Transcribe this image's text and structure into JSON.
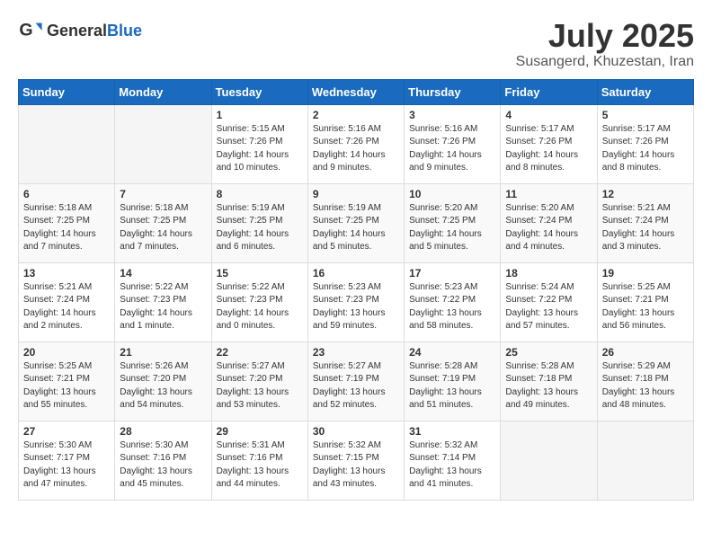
{
  "header": {
    "logo_general": "General",
    "logo_blue": "Blue",
    "month_title": "July 2025",
    "location": "Susangerd, Khuzestan, Iran"
  },
  "weekdays": [
    "Sunday",
    "Monday",
    "Tuesday",
    "Wednesday",
    "Thursday",
    "Friday",
    "Saturday"
  ],
  "weeks": [
    [
      {
        "day": "",
        "info": ""
      },
      {
        "day": "",
        "info": ""
      },
      {
        "day": "1",
        "info": "Sunrise: 5:15 AM\nSunset: 7:26 PM\nDaylight: 14 hours and 10 minutes."
      },
      {
        "day": "2",
        "info": "Sunrise: 5:16 AM\nSunset: 7:26 PM\nDaylight: 14 hours and 9 minutes."
      },
      {
        "day": "3",
        "info": "Sunrise: 5:16 AM\nSunset: 7:26 PM\nDaylight: 14 hours and 9 minutes."
      },
      {
        "day": "4",
        "info": "Sunrise: 5:17 AM\nSunset: 7:26 PM\nDaylight: 14 hours and 8 minutes."
      },
      {
        "day": "5",
        "info": "Sunrise: 5:17 AM\nSunset: 7:26 PM\nDaylight: 14 hours and 8 minutes."
      }
    ],
    [
      {
        "day": "6",
        "info": "Sunrise: 5:18 AM\nSunset: 7:25 PM\nDaylight: 14 hours and 7 minutes."
      },
      {
        "day": "7",
        "info": "Sunrise: 5:18 AM\nSunset: 7:25 PM\nDaylight: 14 hours and 7 minutes."
      },
      {
        "day": "8",
        "info": "Sunrise: 5:19 AM\nSunset: 7:25 PM\nDaylight: 14 hours and 6 minutes."
      },
      {
        "day": "9",
        "info": "Sunrise: 5:19 AM\nSunset: 7:25 PM\nDaylight: 14 hours and 5 minutes."
      },
      {
        "day": "10",
        "info": "Sunrise: 5:20 AM\nSunset: 7:25 PM\nDaylight: 14 hours and 5 minutes."
      },
      {
        "day": "11",
        "info": "Sunrise: 5:20 AM\nSunset: 7:24 PM\nDaylight: 14 hours and 4 minutes."
      },
      {
        "day": "12",
        "info": "Sunrise: 5:21 AM\nSunset: 7:24 PM\nDaylight: 14 hours and 3 minutes."
      }
    ],
    [
      {
        "day": "13",
        "info": "Sunrise: 5:21 AM\nSunset: 7:24 PM\nDaylight: 14 hours and 2 minutes."
      },
      {
        "day": "14",
        "info": "Sunrise: 5:22 AM\nSunset: 7:23 PM\nDaylight: 14 hours and 1 minute."
      },
      {
        "day": "15",
        "info": "Sunrise: 5:22 AM\nSunset: 7:23 PM\nDaylight: 14 hours and 0 minutes."
      },
      {
        "day": "16",
        "info": "Sunrise: 5:23 AM\nSunset: 7:23 PM\nDaylight: 13 hours and 59 minutes."
      },
      {
        "day": "17",
        "info": "Sunrise: 5:23 AM\nSunset: 7:22 PM\nDaylight: 13 hours and 58 minutes."
      },
      {
        "day": "18",
        "info": "Sunrise: 5:24 AM\nSunset: 7:22 PM\nDaylight: 13 hours and 57 minutes."
      },
      {
        "day": "19",
        "info": "Sunrise: 5:25 AM\nSunset: 7:21 PM\nDaylight: 13 hours and 56 minutes."
      }
    ],
    [
      {
        "day": "20",
        "info": "Sunrise: 5:25 AM\nSunset: 7:21 PM\nDaylight: 13 hours and 55 minutes."
      },
      {
        "day": "21",
        "info": "Sunrise: 5:26 AM\nSunset: 7:20 PM\nDaylight: 13 hours and 54 minutes."
      },
      {
        "day": "22",
        "info": "Sunrise: 5:27 AM\nSunset: 7:20 PM\nDaylight: 13 hours and 53 minutes."
      },
      {
        "day": "23",
        "info": "Sunrise: 5:27 AM\nSunset: 7:19 PM\nDaylight: 13 hours and 52 minutes."
      },
      {
        "day": "24",
        "info": "Sunrise: 5:28 AM\nSunset: 7:19 PM\nDaylight: 13 hours and 51 minutes."
      },
      {
        "day": "25",
        "info": "Sunrise: 5:28 AM\nSunset: 7:18 PM\nDaylight: 13 hours and 49 minutes."
      },
      {
        "day": "26",
        "info": "Sunrise: 5:29 AM\nSunset: 7:18 PM\nDaylight: 13 hours and 48 minutes."
      }
    ],
    [
      {
        "day": "27",
        "info": "Sunrise: 5:30 AM\nSunset: 7:17 PM\nDaylight: 13 hours and 47 minutes."
      },
      {
        "day": "28",
        "info": "Sunrise: 5:30 AM\nSunset: 7:16 PM\nDaylight: 13 hours and 45 minutes."
      },
      {
        "day": "29",
        "info": "Sunrise: 5:31 AM\nSunset: 7:16 PM\nDaylight: 13 hours and 44 minutes."
      },
      {
        "day": "30",
        "info": "Sunrise: 5:32 AM\nSunset: 7:15 PM\nDaylight: 13 hours and 43 minutes."
      },
      {
        "day": "31",
        "info": "Sunrise: 5:32 AM\nSunset: 7:14 PM\nDaylight: 13 hours and 41 minutes."
      },
      {
        "day": "",
        "info": ""
      },
      {
        "day": "",
        "info": ""
      }
    ]
  ]
}
